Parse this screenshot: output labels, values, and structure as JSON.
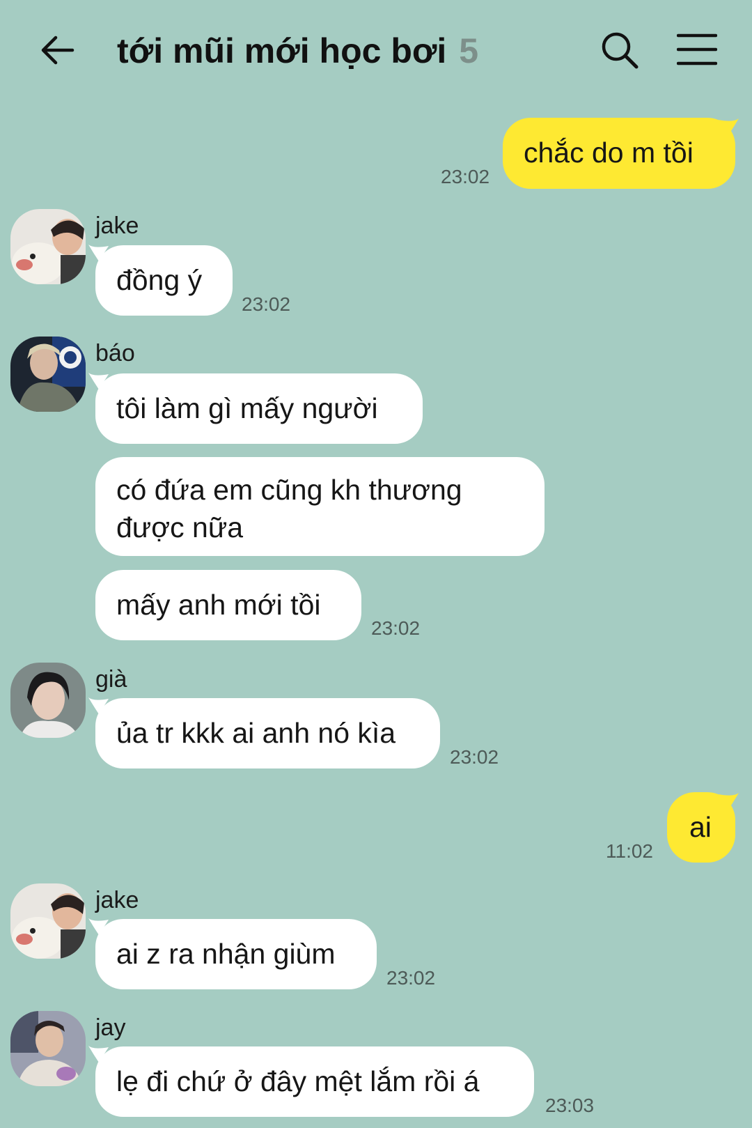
{
  "header": {
    "title": "tới mũi mới học bơi",
    "member_count": "5",
    "icons": [
      "back-arrow-icon",
      "search-icon",
      "menu-icon"
    ]
  },
  "colors": {
    "background": "#a5ccc2",
    "my_bubble": "#fee932",
    "other_bubble": "#ffffff",
    "count_text": "#7d8f8a"
  },
  "messages": [
    {
      "from": "me",
      "text": "chắc do m tồi",
      "time": "23:02"
    },
    {
      "from": "jake",
      "text": "đồng ý",
      "time": "23:02"
    },
    {
      "from": "báo",
      "text": "tôi làm gì mấy người"
    },
    {
      "from": "báo",
      "text": "có đứa em cũng kh thương được nữa"
    },
    {
      "from": "báo",
      "text": "mấy anh mới tồi",
      "time": "23:02"
    },
    {
      "from": "già",
      "text": "ủa tr kkk ai anh nó kìa",
      "time": "23:02"
    },
    {
      "from": "me",
      "text": "ai",
      "time": "11:02"
    },
    {
      "from": "jake",
      "text": "ai z ra nhận giùm",
      "time": "23:02"
    },
    {
      "from": "jay",
      "text": "lẹ đi chứ ở đây mệt lắm rồi á",
      "time": "23:03"
    }
  ]
}
